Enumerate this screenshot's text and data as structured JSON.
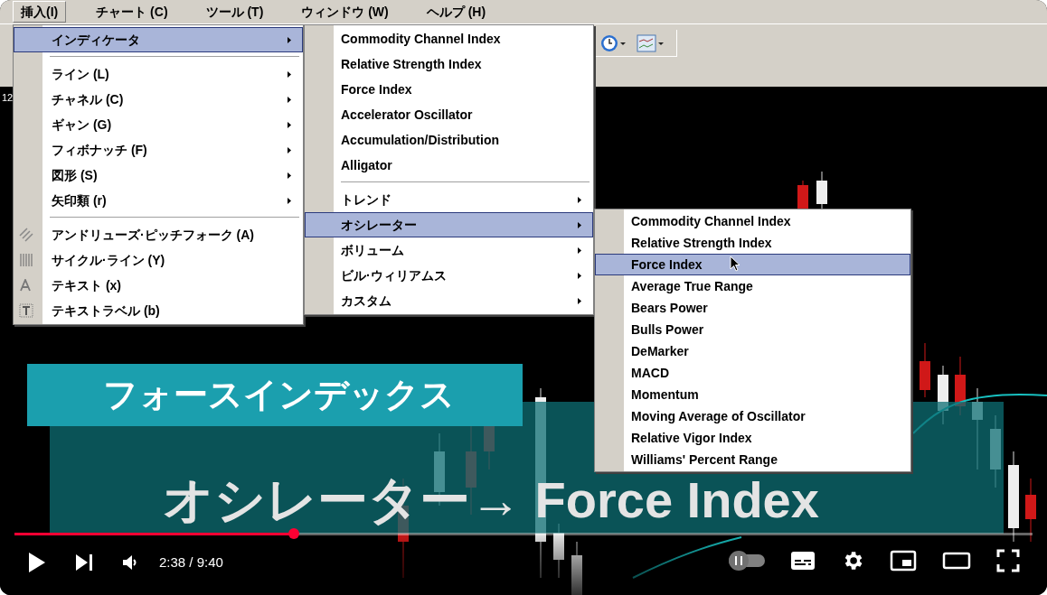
{
  "menu_bar": [
    {
      "label": "挿入(I)",
      "selected": true
    },
    {
      "label": "チャート (C)",
      "selected": false
    },
    {
      "label": "ツール (T)",
      "selected": false
    },
    {
      "label": "ウィンドウ (W)",
      "selected": false
    },
    {
      "label": "ヘルプ (H)",
      "selected": false
    }
  ],
  "chart_label": "12",
  "insert_menu": {
    "groups": [
      [
        {
          "label": "インディケータ",
          "kind": "submenu",
          "selected": true
        }
      ],
      [
        {
          "label": "ライン (L)",
          "kind": "submenu",
          "selected": false
        },
        {
          "label": "チャネル (C)",
          "kind": "submenu",
          "selected": false
        },
        {
          "label": "ギャン (G)",
          "kind": "submenu",
          "selected": false
        },
        {
          "label": "フィボナッチ (F)",
          "kind": "submenu",
          "selected": false
        },
        {
          "label": "図形 (S)",
          "kind": "submenu",
          "selected": false
        },
        {
          "label": "矢印類 (r)",
          "kind": "submenu",
          "selected": false
        }
      ],
      [
        {
          "label": "アンドリューズ·ピッチフォーク (A)",
          "kind": "tool",
          "selected": false
        },
        {
          "label": "サイクル·ライン (Y)",
          "kind": "tool",
          "selected": false
        },
        {
          "label": "テキスト (x)",
          "kind": "tool",
          "selected": false
        },
        {
          "label": "テキストラベル (b)",
          "kind": "tool",
          "selected": false
        }
      ]
    ]
  },
  "indicator_menu": {
    "groups": [
      [
        {
          "label": "Commodity Channel Index",
          "selected": false
        },
        {
          "label": "Relative Strength Index",
          "selected": false
        },
        {
          "label": "Force Index",
          "selected": false
        },
        {
          "label": "Accelerator Oscillator",
          "selected": false
        },
        {
          "label": "Accumulation/Distribution",
          "selected": false
        },
        {
          "label": "Alligator",
          "selected": false
        }
      ],
      [
        {
          "label": "トレンド",
          "kind": "submenu",
          "selected": false
        },
        {
          "label": "オシレーター",
          "kind": "submenu",
          "selected": true
        },
        {
          "label": "ボリューム",
          "kind": "submenu",
          "selected": false
        },
        {
          "label": "ビル·ウィリアムス",
          "kind": "submenu",
          "selected": false
        },
        {
          "label": "カスタム",
          "kind": "submenu",
          "selected": false
        }
      ]
    ]
  },
  "oscillator_menu": {
    "groups": [
      [
        {
          "label": "Commodity Channel Index",
          "selected": false
        },
        {
          "label": "Relative Strength Index",
          "selected": false
        },
        {
          "label": "Force Index",
          "selected": true
        },
        {
          "label": "Average True Range",
          "selected": false
        },
        {
          "label": "Bears Power",
          "selected": false
        },
        {
          "label": "Bulls Power",
          "selected": false
        },
        {
          "label": "DeMarker",
          "selected": false
        },
        {
          "label": "MACD",
          "selected": false
        },
        {
          "label": "Momentum",
          "selected": false
        },
        {
          "label": "Moving Average of Oscillator",
          "selected": false
        },
        {
          "label": "Relative Vigor Index",
          "selected": false
        },
        {
          "label": "Williams' Percent Range",
          "selected": false
        }
      ]
    ]
  },
  "banner": "フォースインデックス",
  "caption": "オシレーター→ Force Index",
  "player": {
    "progress": {
      "level": 0.274
    },
    "time": "2:38 / 9:40",
    "autoplay": false
  }
}
